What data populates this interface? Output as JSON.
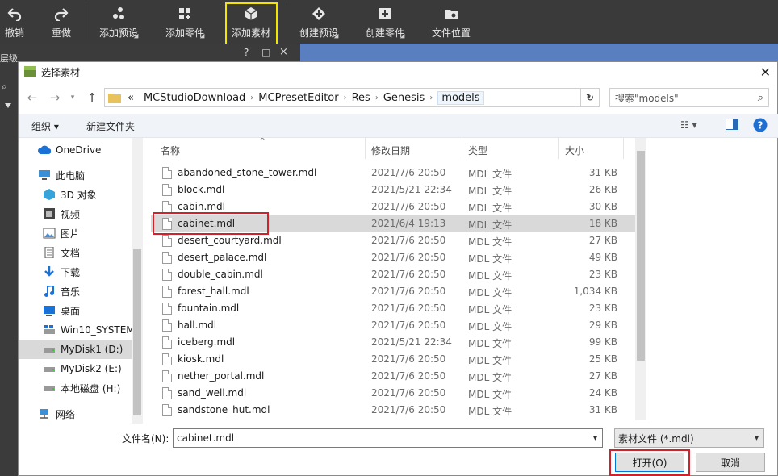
{
  "toolbar": {
    "items": [
      {
        "label": "撤销",
        "icon": "undo-icon"
      },
      {
        "label": "重做",
        "icon": "redo-icon"
      },
      {
        "label": "添加预设",
        "icon": "add-preset-icon"
      },
      {
        "label": "添加零件",
        "icon": "add-part-icon"
      },
      {
        "label": "添加素材",
        "icon": "add-asset-icon"
      },
      {
        "label": "创建预设",
        "icon": "create-preset-icon"
      },
      {
        "label": "创建零件",
        "icon": "create-part-icon"
      },
      {
        "label": "文件位置",
        "icon": "file-location-icon"
      }
    ],
    "highlight_color": "#f2e600"
  },
  "background": {
    "left_label": "层级",
    "mid_buttons": [
      "?",
      "□",
      "×"
    ]
  },
  "dialog": {
    "title": "选择素材",
    "breadcrumb": [
      "«",
      "MCStudioDownload",
      "MCPresetEditor",
      "Res",
      "Genesis",
      "models"
    ],
    "search_placeholder": "搜索\"models\"",
    "organize": "组织 ▾",
    "new_folder": "新建文件夹",
    "nav": [
      {
        "label": "OneDrive",
        "icon": "cloud-icon"
      },
      {
        "label": "此电脑",
        "icon": "computer-icon"
      },
      {
        "label": "3D 对象",
        "icon": "3d-objects-icon"
      },
      {
        "label": "视频",
        "icon": "video-icon"
      },
      {
        "label": "图片",
        "icon": "pictures-icon"
      },
      {
        "label": "文档",
        "icon": "documents-icon"
      },
      {
        "label": "下载",
        "icon": "download-icon"
      },
      {
        "label": "音乐",
        "icon": "music-icon"
      },
      {
        "label": "桌面",
        "icon": "desktop-icon"
      },
      {
        "label": "Win10_SYSTEM",
        "icon": "drive-icon"
      },
      {
        "label": "MyDisk1 (D:)",
        "icon": "drive-icon"
      },
      {
        "label": "MyDisk2 (E:)",
        "icon": "drive-icon"
      },
      {
        "label": "本地磁盘 (H:)",
        "icon": "drive-icon"
      },
      {
        "label": "网络",
        "icon": "network-icon"
      }
    ],
    "columns": [
      "名称",
      "修改日期",
      "类型",
      "大小"
    ],
    "files": [
      {
        "name": "abandoned_stone_tower.mdl",
        "date": "2021/7/6 20:50",
        "type": "MDL 文件",
        "size": "31 KB"
      },
      {
        "name": "block.mdl",
        "date": "2021/5/21 22:34",
        "type": "MDL 文件",
        "size": "26 KB"
      },
      {
        "name": "cabin.mdl",
        "date": "2021/7/6 20:50",
        "type": "MDL 文件",
        "size": "30 KB"
      },
      {
        "name": "cabinet.mdl",
        "date": "2021/6/4 19:13",
        "type": "MDL 文件",
        "size": "18 KB"
      },
      {
        "name": "desert_courtyard.mdl",
        "date": "2021/7/6 20:50",
        "type": "MDL 文件",
        "size": "27 KB"
      },
      {
        "name": "desert_palace.mdl",
        "date": "2021/7/6 20:50",
        "type": "MDL 文件",
        "size": "49 KB"
      },
      {
        "name": "double_cabin.mdl",
        "date": "2021/7/6 20:50",
        "type": "MDL 文件",
        "size": "23 KB"
      },
      {
        "name": "forest_hall.mdl",
        "date": "2021/7/6 20:50",
        "type": "MDL 文件",
        "size": "1,034 KB"
      },
      {
        "name": "fountain.mdl",
        "date": "2021/7/6 20:50",
        "type": "MDL 文件",
        "size": "23 KB"
      },
      {
        "name": "hall.mdl",
        "date": "2021/7/6 20:50",
        "type": "MDL 文件",
        "size": "29 KB"
      },
      {
        "name": "iceberg.mdl",
        "date": "2021/5/21 22:34",
        "type": "MDL 文件",
        "size": "99 KB"
      },
      {
        "name": "kiosk.mdl",
        "date": "2021/7/6 20:50",
        "type": "MDL 文件",
        "size": "25 KB"
      },
      {
        "name": "nether_portal.mdl",
        "date": "2021/7/6 20:50",
        "type": "MDL 文件",
        "size": "27 KB"
      },
      {
        "name": "sand_well.mdl",
        "date": "2021/7/6 20:50",
        "type": "MDL 文件",
        "size": "24 KB"
      },
      {
        "name": "sandstone_hut.mdl",
        "date": "2021/7/6 20:50",
        "type": "MDL 文件",
        "size": "31 KB"
      }
    ],
    "filename_label": "文件名(N):",
    "filename_value": "cabinet.mdl",
    "filetype_value": "素材文件 (*.mdl)",
    "open_label": "打开(O)",
    "cancel_label": "取消",
    "annotation_color": "#d0222a"
  }
}
